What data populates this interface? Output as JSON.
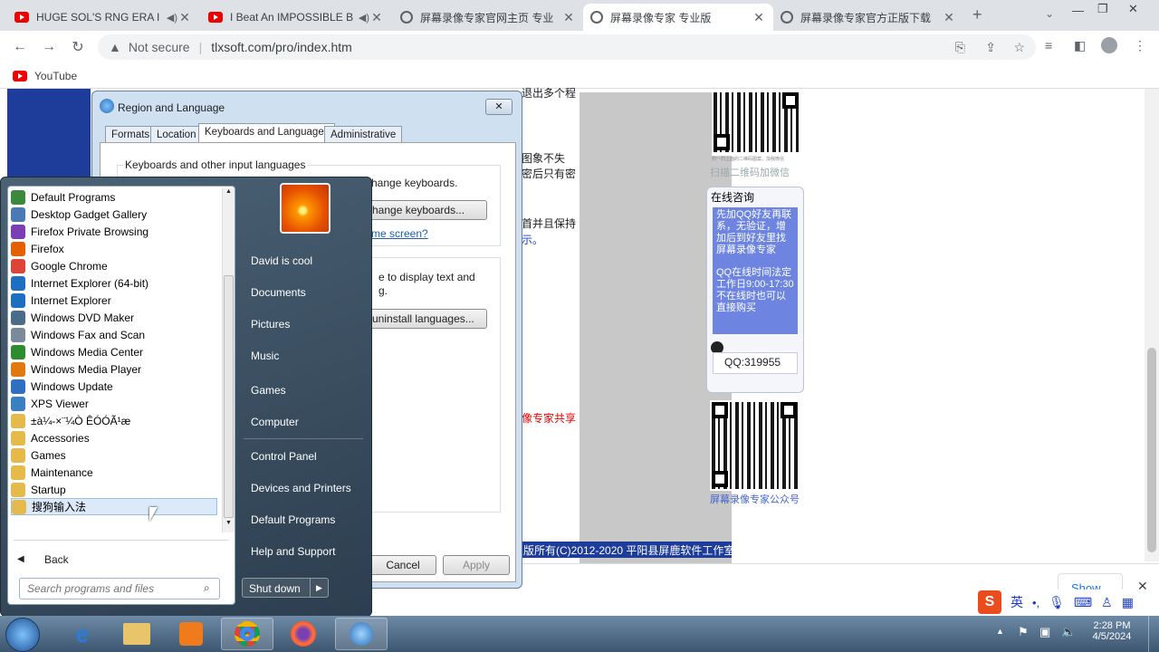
{
  "browser": {
    "tabs": [
      {
        "title": "HUGE SOL'S RNG ERA I",
        "icon": "youtube-icon",
        "audio": true
      },
      {
        "title": "I Beat An IMPOSSIBLE B",
        "icon": "youtube-icon",
        "audio": true
      },
      {
        "title": "屏幕录像专家官网主页 专业",
        "icon": "globe-icon"
      },
      {
        "title": "屏幕录像专家 专业版",
        "icon": "globe-icon",
        "active": true
      },
      {
        "title": "屏幕录像专家官方正版下载",
        "icon": "globe-icon"
      }
    ],
    "security": "Not secure",
    "url": "tlxsoft.com/pro/index.htm",
    "bookmark": "YouTube"
  },
  "webpage": {
    "snip1": "退出多个程",
    "snip2": "图象不失",
    "snip3": "密后只有密",
    "snip4": "首并且保持",
    "snip5": "示。",
    "snip6": "像专家共享",
    "wechat_scan": "扫描二维码加微信",
    "qq_header": "在线咨询",
    "qq_notice": "先加QQ好友再联系，无验证，增加后到好友里找 屏幕录像专家",
    "qq_hours": "QQ在线时间法定工作日9:00-17:30",
    "qq_offline": "不在线时也可以直接购买",
    "qq_number": "QQ:319955",
    "public_account": "屏幕录像专家公众号",
    "copyright": "版所有(C)2012-2020 平阳县屏鹿软件工作室",
    "show_all": "Show all",
    "qr_caption": "扫一扫上面的二维码图案，加我微信"
  },
  "dialog": {
    "title": "Region and Language",
    "tabs": [
      "Formats",
      "Location",
      "Keyboards and Languages",
      "Administrative"
    ],
    "group1_title": "Keyboards and other input languages",
    "text1": "hange keyboards.",
    "btn1": "hange keyboards...",
    "link1": "me screen?",
    "text2a": "e to display text and",
    "text2b": "g.",
    "btn2": "uninstall languages...",
    "cancel": "Cancel",
    "apply": "Apply"
  },
  "startmenu": {
    "programs": [
      {
        "label": "Default Programs",
        "color": "#3b8a3b"
      },
      {
        "label": "Desktop Gadget Gallery",
        "color": "#4a7ab5"
      },
      {
        "label": "Firefox Private Browsing",
        "color": "#7b3fb5"
      },
      {
        "label": "Firefox",
        "color": "#e66000"
      },
      {
        "label": "Google Chrome",
        "color": "#db4437"
      },
      {
        "label": "Internet Explorer (64-bit)",
        "color": "#1e6fc0"
      },
      {
        "label": "Internet Explorer",
        "color": "#1e6fc0"
      },
      {
        "label": "Windows DVD Maker",
        "color": "#4b6b8a"
      },
      {
        "label": "Windows Fax and Scan",
        "color": "#7a8a9a"
      },
      {
        "label": "Windows Media Center",
        "color": "#2e8b2e"
      },
      {
        "label": "Windows Media Player",
        "color": "#e07a10"
      },
      {
        "label": "Windows Update",
        "color": "#2f6fc2"
      },
      {
        "label": "XPS Viewer",
        "color": "#3a7fc0"
      },
      {
        "label": "±à¼-×¨¼Ò ÊÓÓÃ¹æ",
        "color": "#e5b94a"
      },
      {
        "label": "Accessories",
        "color": "#e5b94a"
      },
      {
        "label": "Games",
        "color": "#e5b94a"
      },
      {
        "label": "Maintenance",
        "color": "#e5b94a"
      },
      {
        "label": "Startup",
        "color": "#e5b94a"
      },
      {
        "label": "搜狗输入法",
        "color": "#e5b94a"
      }
    ],
    "back": "Back",
    "search_placeholder": "Search programs and files",
    "right": [
      "David is cool",
      "Documents",
      "Pictures",
      "Music",
      "Games",
      "Computer",
      "Control Panel",
      "Devices and Printers",
      "Default Programs",
      "Help and Support"
    ],
    "shutdown": "Shut down"
  },
  "taskbar": {
    "time": "2:28 PM",
    "date": "4/5/2024",
    "ime": "英"
  }
}
